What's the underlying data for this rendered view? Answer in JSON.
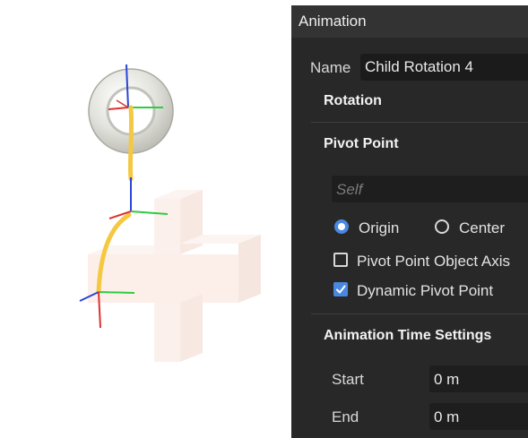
{
  "panel": {
    "title": "Animation",
    "name_label": "Name",
    "name_value": "Child Rotation 4",
    "section_rotation": "Rotation",
    "section_pivot": "Pivot Point",
    "pivot_object_placeholder": "Self",
    "radio_origin_label": "Origin",
    "radio_origin_selected": true,
    "radio_center_label": "Center",
    "radio_center_selected": false,
    "pivot_object_axis_label": "Pivot Point Object Axis",
    "pivot_object_axis_checked": false,
    "dynamic_pivot_label": "Dynamic Pivot Point",
    "dynamic_pivot_checked": true,
    "section_time": "Animation Time Settings",
    "start_label": "Start",
    "start_value": "0 m",
    "end_label": "End",
    "end_value": "0 m"
  },
  "viewport": {
    "objects": [
      "torus",
      "cross",
      "rotation-path",
      "axis-gizmos"
    ],
    "colors": {
      "path": "#f5c842",
      "axis_x": "#2ecc40",
      "axis_y": "#e03030",
      "axis_z": "#2040d0",
      "torus": "#e8e8e2",
      "cross": "#f8e4dc"
    }
  }
}
